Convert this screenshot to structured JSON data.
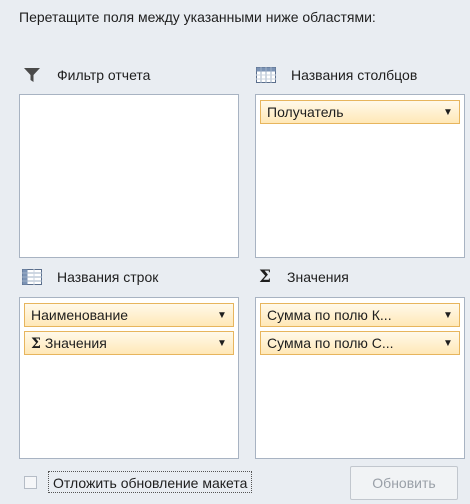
{
  "instruction": "Перетащите поля между указанными ниже областями:",
  "areas": {
    "report_filter": {
      "title": "Фильтр отчета",
      "icon": "filter-icon",
      "fields": []
    },
    "column_labels": {
      "title": "Названия столбцов",
      "icon": "column-labels-icon",
      "fields": [
        "Получатель"
      ]
    },
    "row_labels": {
      "title": "Названия строк",
      "icon": "row-labels-icon",
      "fields": [
        "Наименование",
        "Значения"
      ]
    },
    "values": {
      "title": "Значения",
      "icon": "sigma-icon",
      "fields": [
        "Сумма по полю К...",
        "Сумма по полю С..."
      ]
    }
  },
  "footer": {
    "defer_label": "Отложить обновление макета",
    "defer_checked": false,
    "update_button": "Обновить"
  }
}
